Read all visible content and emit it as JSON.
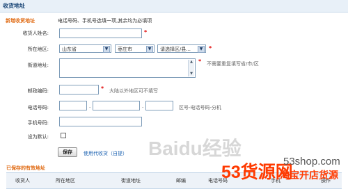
{
  "header": {
    "title": "收货地址"
  },
  "form": {
    "section_title": "新增收货地址",
    "note": "电话号码、手机号选填一项,其余均为必填项",
    "labels": {
      "recipient": "收货人姓名:",
      "region": "所在地区:",
      "street": "街道地址:",
      "postcode": "邮政编码:",
      "phone": "电话号码:",
      "mobile": "手机号码:",
      "default": "设为默认:"
    },
    "required_mark": "*",
    "region": {
      "province": "山东省",
      "city": "枣庄市",
      "district": "请选择区/县..."
    },
    "hints": {
      "street": "不需要重复填写省/市/区",
      "postcode": "大陆以外地区可不填写",
      "phone": "区号-电话号码-分机"
    },
    "separators": {
      "dot": "."
    },
    "save_label": "保存",
    "link_text": "使用代收货（自提）"
  },
  "saved": {
    "title": "已保存的有效地址",
    "columns": [
      "收货人",
      "所在地区",
      "街道地址",
      "邮编",
      "电话号码",
      "手机",
      "操作"
    ]
  },
  "watermarks": {
    "baidu": "Baidu经验",
    "brand_main": "53货源网",
    "brand_site": "53shop.com",
    "brand_sub": "淘宝开店货源"
  },
  "colors": {
    "accent": "#e06a12",
    "link": "#1d63b2",
    "required": "#e00000",
    "brand": "#ff3a00"
  }
}
